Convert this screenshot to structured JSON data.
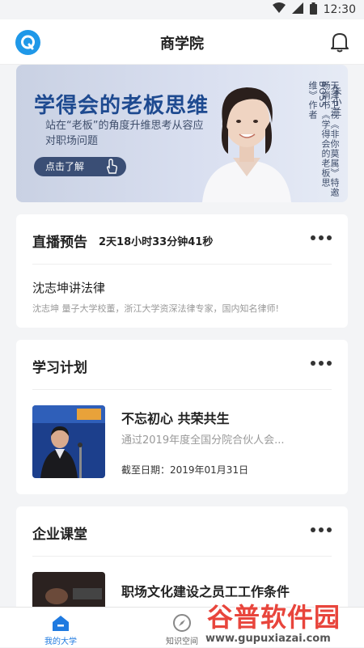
{
  "status_bar": {
    "time": "12:30"
  },
  "app_bar": {
    "title": "商学院"
  },
  "banner": {
    "headline": "学得会的老板思维",
    "subtitle": "站在“老板”的角度升维思考从容应对职场问题",
    "button_label": "点击了解",
    "person_name": "朱小兰",
    "person_title_1": "天津卫视《非你莫属》特邀BOSS",
    "person_title_2": "畅销书《学得会的老板思维》作者",
    "carousel_active_index": 1,
    "carousel_count": 2
  },
  "live_preview": {
    "title": "直播预告",
    "countdown": "2天18小时33分钟41秒",
    "item_title": "沈志坤讲法律",
    "item_desc": "沈志坤 量子大学校董，浙江大学资深法律专家，国内知名律师!"
  },
  "study_plan": {
    "title": "学习计划",
    "course_name": "不忘初心 共荣共生",
    "course_desc": "通过2019年度全国分院合伙人会...",
    "deadline_label": "截至日期：2019年01月31日"
  },
  "enterprise_class": {
    "title": "企业课堂",
    "course_name": "职场文化建设之员工工作条件"
  },
  "tab_bar": {
    "tabs": [
      {
        "label": "我的大学",
        "active": true
      },
      {
        "label": "知识空间",
        "active": false
      }
    ],
    "active_color": "#1f7ae0"
  },
  "watermark": {
    "text": "谷普软件园",
    "url": "www.gupuxiazai.com"
  },
  "colors": {
    "accent": "#1f98e8",
    "banner_title": "#1e4a90",
    "watermark_red": "#e8453c"
  }
}
